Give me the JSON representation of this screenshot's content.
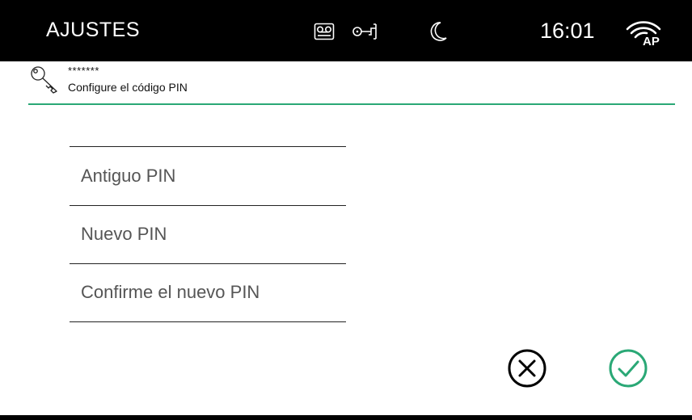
{
  "topbar": {
    "title": "AJUSTES",
    "time": "16:01",
    "icons": [
      "voicemail-icon",
      "door-key-icon",
      "night-mode-icon",
      "wifi-ap-icon"
    ],
    "wifi_badge": "AP"
  },
  "header": {
    "icon": "key-icon",
    "pin_mask": "*******",
    "subtitle": "Configure el código PIN"
  },
  "form": {
    "fields": [
      {
        "label": "Antiguo PIN"
      },
      {
        "label": "Nuevo PIN"
      },
      {
        "label": "Confirme el nuevo PIN"
      }
    ]
  },
  "actions": {
    "cancel_icon": "cancel-icon",
    "confirm_icon": "confirm-icon"
  },
  "colors": {
    "accent": "#2aa876",
    "topbar_bg": "#000000",
    "confirm": "#2aa876",
    "cancel": "#000000"
  }
}
